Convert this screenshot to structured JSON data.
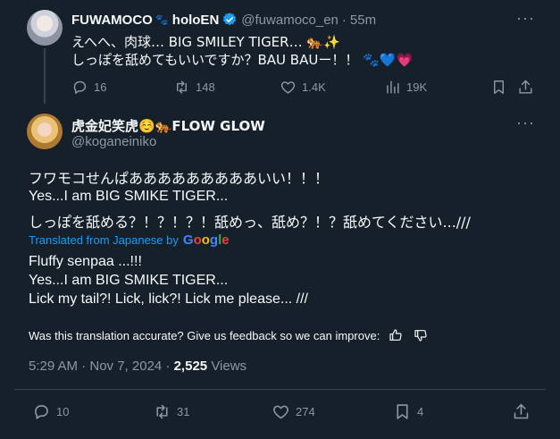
{
  "top_tweet": {
    "display_name": "FUWAMOCO",
    "name_suffix": "holoEN",
    "handle": "@fuwamoco_en",
    "time": "55m",
    "line1": "えへへ、肉球… BIG SMILEY TIGER… 🐅✨",
    "line2": "しっぽを舐めてもいいですか？BAU BAUー！！ 🐾💙💗",
    "stats": {
      "replies": "16",
      "retweets": "148",
      "likes": "1.4K",
      "views": "19K"
    }
  },
  "main_tweet": {
    "display_name": "虎金妃笑虎☺️🐅FLOW GLOW",
    "handle": "@koganeiniko",
    "body_lines": [
      "フワモコせんぱあああああああああいい！！！",
      "Yes...I am BIG SMIKE TIGER...",
      "しっぽを舐める？！？！？！舐めっ、舐め？！？舐めてください...///"
    ],
    "translated_from": "Translated from Japanese by",
    "google": [
      "G",
      "o",
      "o",
      "g",
      "l",
      "e"
    ],
    "translation_lines": [
      "Fluffy senpaa ...!!!",
      "Yes...I am BIG SMIKE TIGER...",
      "Lick my tail?! Lick, lick?! Lick me please... ///"
    ],
    "feedback": "Was this translation accurate? Give us feedback so we can improve:",
    "timestamp": "5:29 AM · Nov 7, 2024 ·",
    "views_count": "2,525",
    "views_label": "Views",
    "stats": {
      "replies": "10",
      "retweets": "31",
      "likes": "274",
      "bookmarks": "4"
    }
  }
}
